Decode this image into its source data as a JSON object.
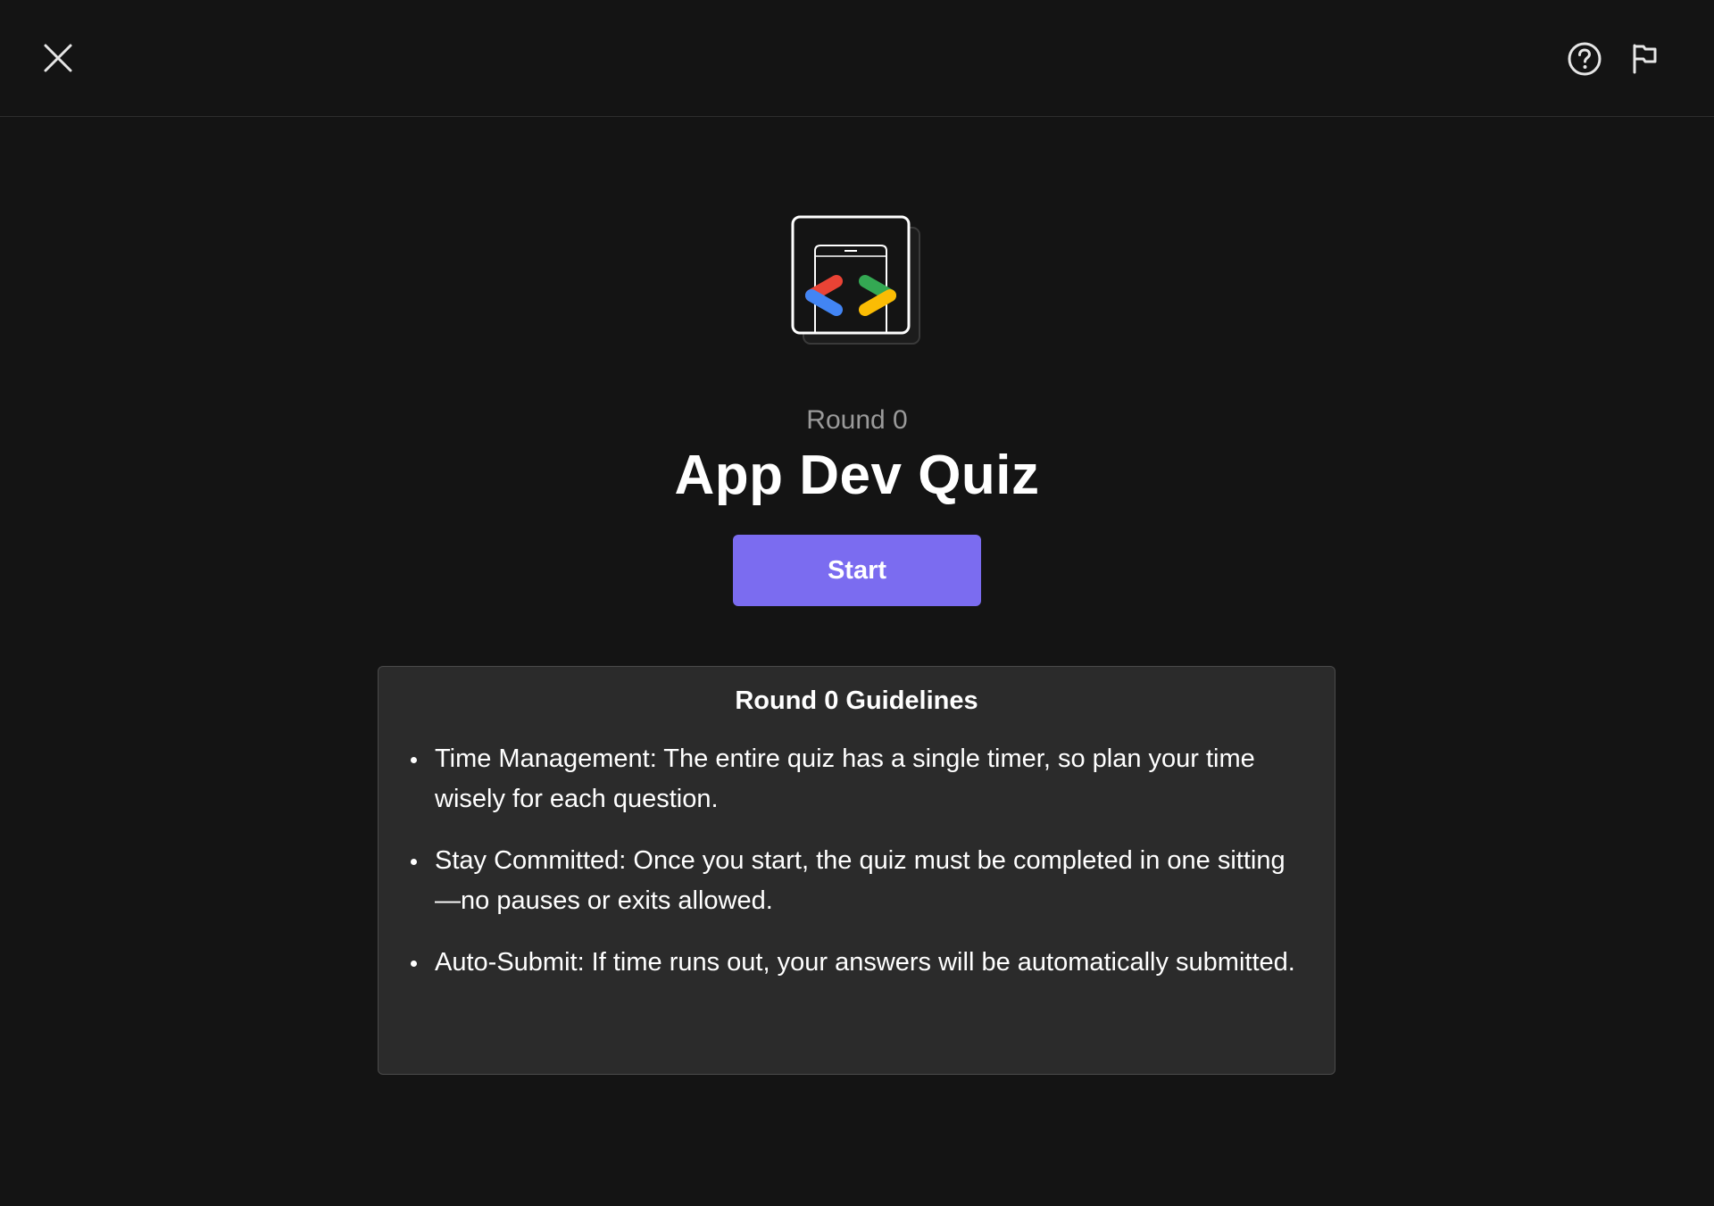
{
  "header": {
    "close_icon": "close-icon",
    "help_icon": "help-circle-icon",
    "flag_icon": "flag-icon"
  },
  "quiz": {
    "logo_icon": "app-dev-logo-icon",
    "round_label": "Round 0",
    "title": "App Dev Quiz",
    "start_label": "Start"
  },
  "guidelines": {
    "title": "Round 0 Guidelines",
    "items": [
      "Time Management: The entire quiz has a single timer, so plan your time wisely for each question.",
      "Stay Committed: Once you start, the quiz must be completed in one sitting—no pauses or exits allowed.",
      "Auto-Submit: If time runs out, your answers will be automatically submitted."
    ]
  },
  "colors": {
    "background": "#141414",
    "accent": "#7b6cf0",
    "panel": "#2b2b2b",
    "logo_red": "#ea4335",
    "logo_green": "#34a853",
    "logo_blue": "#4285f4",
    "logo_yellow": "#fbbc04"
  }
}
